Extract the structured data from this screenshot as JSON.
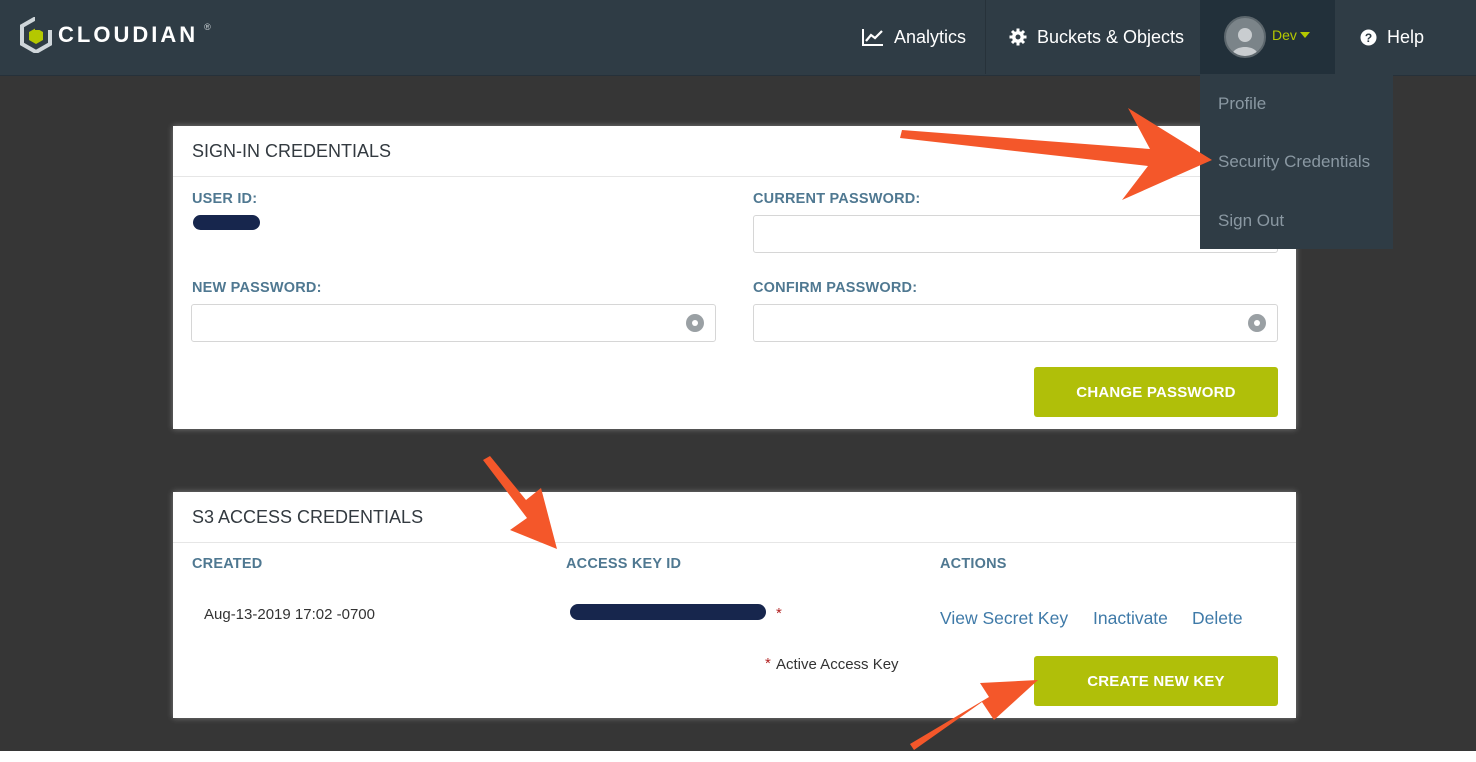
{
  "app": {
    "logo_text": "CLOUDIAN",
    "logo_tm": "®"
  },
  "nav": {
    "analytics": "Analytics",
    "buckets": "Buckets & Objects",
    "user": "Dev",
    "help": "Help"
  },
  "user_menu": {
    "items": [
      "Profile",
      "Security Credentials",
      "Sign Out"
    ]
  },
  "signin": {
    "title": "SIGN-IN CREDENTIALS",
    "user_id_label": "USER ID:",
    "current_password_label": "CURRENT PASSWORD:",
    "new_password_label": "NEW PASSWORD:",
    "confirm_password_label": "CONFIRM PASSWORD:",
    "current_password_value": "",
    "new_password_value": "",
    "confirm_password_value": "",
    "change_password_button": "CHANGE PASSWORD"
  },
  "s3": {
    "title": "S3 ACCESS CREDENTIALS",
    "columns": [
      "CREATED",
      "ACCESS KEY ID",
      "ACTIONS"
    ],
    "rows": [
      {
        "created": "Aug-13-2019 17:02 -0700",
        "marker": "*",
        "actions": [
          "View Secret Key",
          "Inactivate",
          "Delete"
        ]
      }
    ],
    "legend_marker": "*",
    "legend_text": "Active Access Key",
    "create_button": "CREATE NEW KEY"
  },
  "colors": {
    "nav_bg": "#2f3c45",
    "accent_green": "#b0bf09",
    "label_blue": "#4f7891",
    "link_blue": "#3f7aa8",
    "annotation_arrow": "#f4572a"
  }
}
